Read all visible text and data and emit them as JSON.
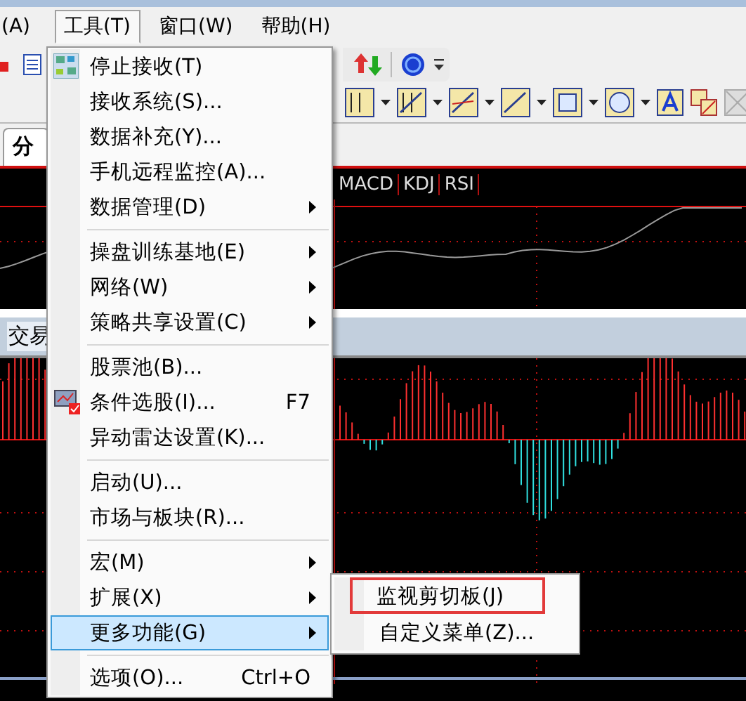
{
  "menubar": [
    {
      "label": "(A)",
      "selected": false
    },
    {
      "label": "工具(T)",
      "selected": true
    },
    {
      "label": "窗口(W)",
      "selected": false
    },
    {
      "label": "帮助(H)",
      "selected": false
    }
  ],
  "tabs": [
    {
      "label": "分",
      "selected": true
    }
  ],
  "indicator_tabs": [
    "MACD",
    "KDJ",
    "RSI"
  ],
  "panel_label": "交易",
  "menu": {
    "items": [
      {
        "kind": "icon_item",
        "label": "停止接收(T)",
        "submenu": false,
        "selected": false
      },
      {
        "kind": "item",
        "label": "接收系统(S)...",
        "submenu": false,
        "selected": false
      },
      {
        "kind": "item",
        "label": "数据补充(Y)...",
        "submenu": false,
        "selected": false
      },
      {
        "kind": "item",
        "label": "手机远程监控(A)...",
        "submenu": false,
        "selected": false
      },
      {
        "kind": "item",
        "label": "数据管理(D)",
        "submenu": true,
        "selected": false
      },
      {
        "kind": "separator"
      },
      {
        "kind": "item",
        "label": "操盘训练基地(E)",
        "submenu": true,
        "selected": false
      },
      {
        "kind": "item",
        "label": "网络(W)",
        "submenu": true,
        "selected": false
      },
      {
        "kind": "item",
        "label": "策略共享设置(C)",
        "submenu": true,
        "selected": false
      },
      {
        "kind": "separator"
      },
      {
        "kind": "item",
        "label": "股票池(B)...",
        "submenu": false,
        "selected": false
      },
      {
        "kind": "icon_item",
        "label": "条件选股(I)...",
        "shortcut": "F7",
        "submenu": false,
        "selected": false
      },
      {
        "kind": "item",
        "label": "异动雷达设置(K)...",
        "submenu": false,
        "selected": false
      },
      {
        "kind": "separator"
      },
      {
        "kind": "item",
        "label": "启动(U)...",
        "submenu": false,
        "selected": false
      },
      {
        "kind": "item",
        "label": "市场与板块(R)...",
        "submenu": false,
        "selected": false
      },
      {
        "kind": "separator"
      },
      {
        "kind": "item",
        "label": "宏(M)",
        "submenu": true,
        "selected": false
      },
      {
        "kind": "item",
        "label": "扩展(X)",
        "submenu": true,
        "selected": false
      },
      {
        "kind": "item",
        "label": "更多功能(G)",
        "submenu": true,
        "selected": true
      },
      {
        "kind": "separator"
      },
      {
        "kind": "item",
        "label": "选项(O)...",
        "shortcut": "Ctrl+O",
        "submenu": false,
        "selected": false
      }
    ]
  },
  "submenu": {
    "items": [
      {
        "label": "监视剪切板(J)",
        "highlighted": true
      },
      {
        "label": "自定义菜单(Z)...",
        "highlighted": false
      }
    ]
  }
}
